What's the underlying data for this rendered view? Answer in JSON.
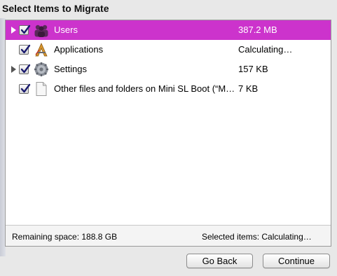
{
  "title": "Select Items to Migrate",
  "items": [
    {
      "label": "Users",
      "size": "387.2 MB",
      "icon": "users-icon",
      "checked": true,
      "expandable": true,
      "selected": true
    },
    {
      "label": "Applications",
      "size": "Calculating…",
      "icon": "applications-icon",
      "checked": true,
      "expandable": false,
      "selected": false
    },
    {
      "label": "Settings",
      "size": "157 KB",
      "icon": "settings-gear-icon",
      "checked": true,
      "expandable": true,
      "selected": false
    },
    {
      "label": "Other files and folders on Mini SL Boot (“M…",
      "size": "7 KB",
      "icon": "document-icon",
      "checked": true,
      "expandable": false,
      "selected": false
    }
  ],
  "status": {
    "remaining": "Remaining space: 188.8 GB",
    "selected": "Selected items: Calculating…"
  },
  "buttons": {
    "back": "Go Back",
    "continue": "Continue"
  },
  "colors": {
    "selection": "#cc33cc",
    "checkmark": "#1a1a6e"
  }
}
